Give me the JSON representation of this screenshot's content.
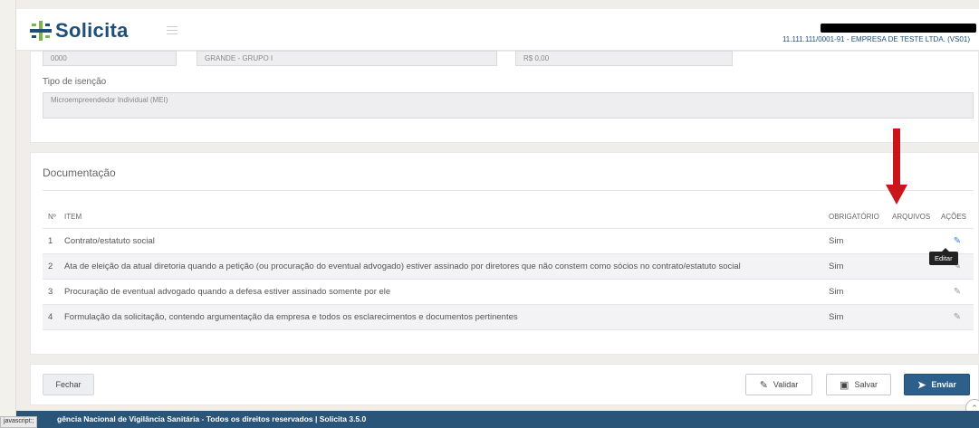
{
  "header": {
    "app_name": "Solicita",
    "company": "11.111.111/0001-91 - EMPRESA DE TESTE LTDA. (VS01)"
  },
  "top_fields": {
    "field1": "0000",
    "field2": "GRANDE - GRUPO I",
    "field3": "R$ 0,00",
    "exemption_label": "Tipo de isenção",
    "exemption_value": "Microempreendedor Individual (MEI)"
  },
  "documentation": {
    "title": "Documentação",
    "columns": {
      "num": "Nº",
      "item": "ITEM",
      "required": "OBRIGATÓRIO",
      "files": "ARQUIVOS",
      "actions": "AÇÕES"
    },
    "rows": [
      {
        "num": "1",
        "item": "Contrato/estatuto social",
        "required": "Sim"
      },
      {
        "num": "2",
        "item": "Ata de eleição da atual diretoria quando a petição (ou procuração do eventual advogado) estiver assinado por diretores que não constem como sócios no contrato/estatuto social",
        "required": "Sim"
      },
      {
        "num": "3",
        "item": "Procuração de eventual advogado quando a defesa estiver assinado somente por ele",
        "required": "Sim"
      },
      {
        "num": "4",
        "item": "Formulação da solicitação, contendo argumentação da empresa e todos os esclarecimentos e documentos pertinentes",
        "required": "Sim"
      }
    ],
    "tooltip": "Editar"
  },
  "footer_buttons": {
    "close": "Fechar",
    "validate": "Validar",
    "save": "Salvar",
    "send": "Enviar"
  },
  "footer": {
    "text": "gência Nacional de Vigilância Sanitária - Todos os direitos reservados | Solicita 3.5.0",
    "status_tip": "javascript:;"
  },
  "colors": {
    "brand": "#1f4e79",
    "accent_green": "#7ab648",
    "annotation_arrow": "#c9151b",
    "send_button": "#2c5f8a",
    "footer_bar": "#2a5579"
  }
}
